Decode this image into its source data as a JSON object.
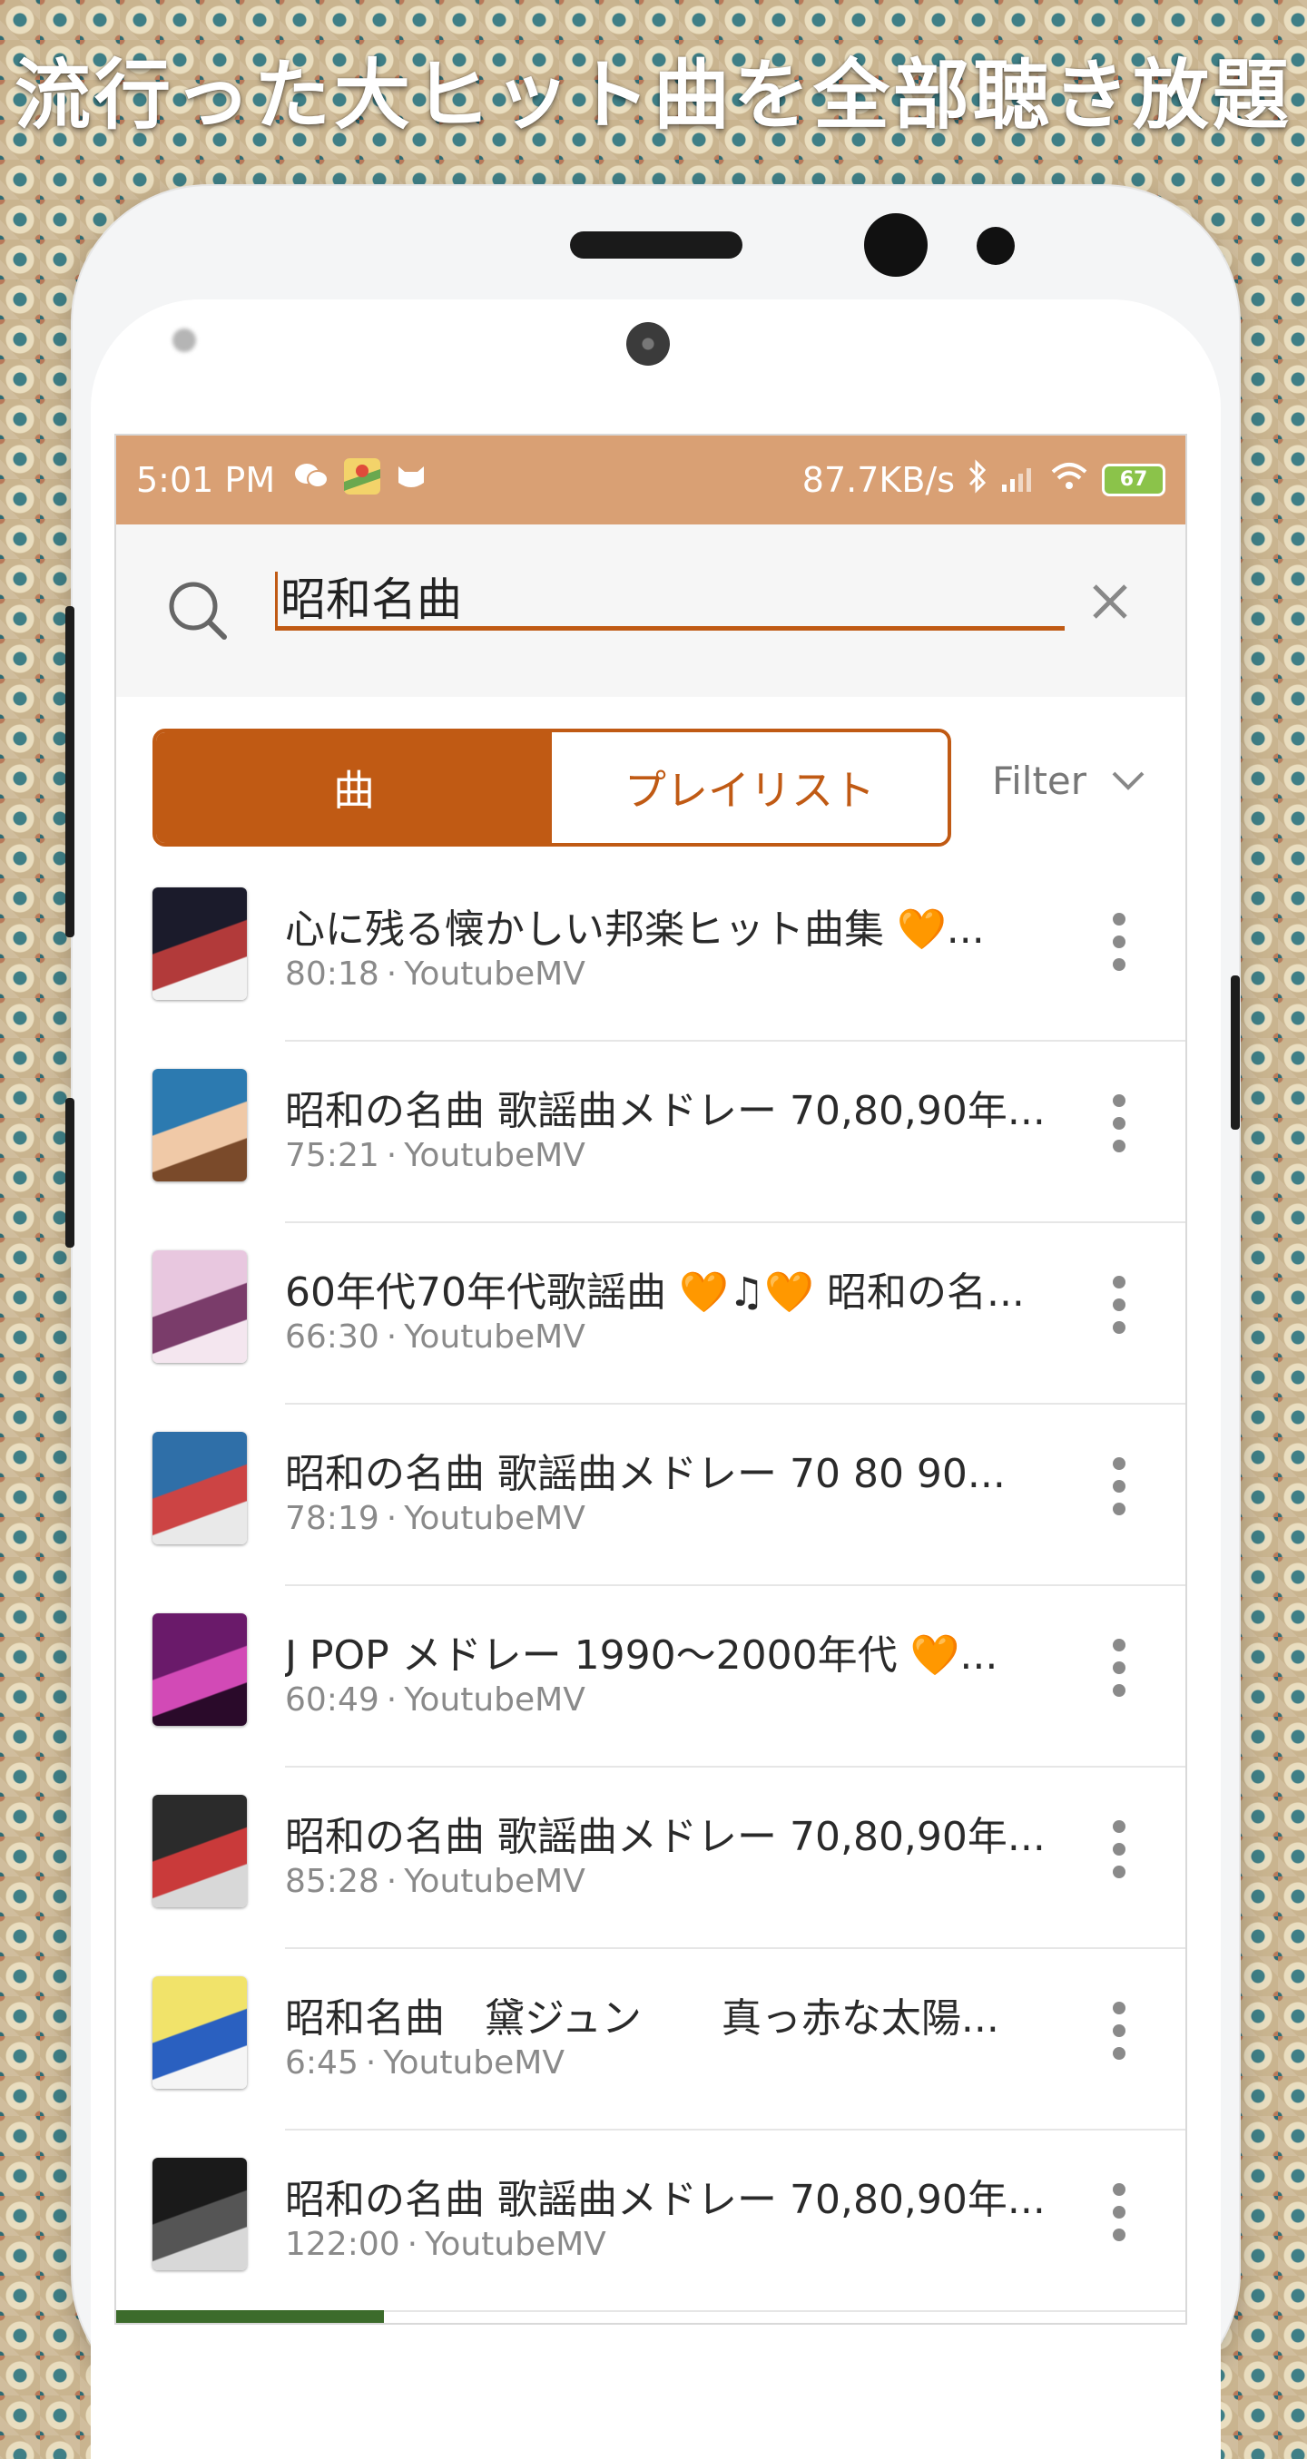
{
  "headline": "流行った大ヒット曲を全部聴き放題",
  "status_bar": {
    "time": "5:01 PM",
    "speed": "87.7KB/s",
    "battery": "67",
    "icons": [
      "wechat-icon",
      "maps-icon",
      "cat-icon",
      "bluetooth-icon",
      "signal-icon",
      "wifi-icon",
      "battery-icon"
    ]
  },
  "search": {
    "query": "昭和名曲",
    "accent_color": "#c05a14"
  },
  "tabs": [
    {
      "label": "曲",
      "active": true
    },
    {
      "label": "プレイリスト",
      "active": false
    }
  ],
  "filter_label": "Filter",
  "tracks": [
    {
      "title": "心に残る懐かしい邦楽ヒット曲集 🧡...",
      "duration": "80:18",
      "source": "YoutubeMV",
      "thumb_colors": [
        "#1b1b2b",
        "#b23a3a",
        "#f2f2f2"
      ]
    },
    {
      "title": "昭和の名曲 歌謡曲メドレー 70,80,90年...",
      "duration": "75:21",
      "source": "YoutubeMV",
      "thumb_colors": [
        "#2c7ab0",
        "#f0c9a7",
        "#7a4a2a"
      ]
    },
    {
      "title": "60年代70年代歌謡曲 🧡♫🧡 昭和の名...",
      "duration": "66:30",
      "source": "YoutubeMV",
      "thumb_colors": [
        "#e8c7df",
        "#7a3c6a",
        "#f4e6ef"
      ]
    },
    {
      "title": "昭和の名曲 歌謡曲メドレー 70 80 90...",
      "duration": "78:19",
      "source": "YoutubeMV",
      "thumb_colors": [
        "#2f6fa8",
        "#c44",
        "#e9e9e9"
      ]
    },
    {
      "title": "J POP メドレー 1990～2000年代 🧡...",
      "duration": "60:49",
      "source": "YoutubeMV",
      "thumb_colors": [
        "#6a1a6a",
        "#d24ab6",
        "#2a0a2a"
      ]
    },
    {
      "title": "昭和の名曲 歌謡曲メドレー 70,80,90年...",
      "duration": "85:28",
      "source": "YoutubeMV",
      "thumb_colors": [
        "#2b2b2b",
        "#c93a3a",
        "#d8d8d8"
      ]
    },
    {
      "title": "昭和名曲　黛ジュン　　真っ赤な太陽...",
      "duration": "6:45",
      "source": "YoutubeMV",
      "thumb_colors": [
        "#f1e36a",
        "#2a60c0",
        "#f5f5f5"
      ]
    },
    {
      "title": "昭和の名曲 歌謡曲メドレー 70,80,90年...",
      "duration": "122:00",
      "source": "YoutubeMV",
      "thumb_colors": [
        "#1a1a1a",
        "#555",
        "#d8d8d8"
      ]
    }
  ],
  "meta_separator": "·"
}
